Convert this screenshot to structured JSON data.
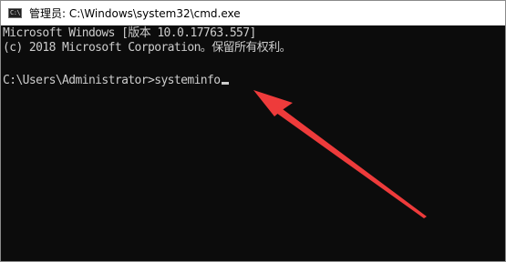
{
  "window": {
    "title": "管理员: C:\\Windows\\system32\\cmd.exe",
    "icon": "cmd-icon",
    "icon_glyph": "C:\\"
  },
  "console": {
    "lines": [
      "Microsoft Windows [版本 10.0.17763.557]",
      "(c) 2018 Microsoft Corporation。保留所有权利。"
    ],
    "prompt": "C:\\Users\\Administrator>",
    "command": "systeminfo"
  },
  "colors": {
    "console_bg": "#0c0c0c",
    "console_text": "#cccccc",
    "annotation_arrow": "#ee3b3b"
  }
}
